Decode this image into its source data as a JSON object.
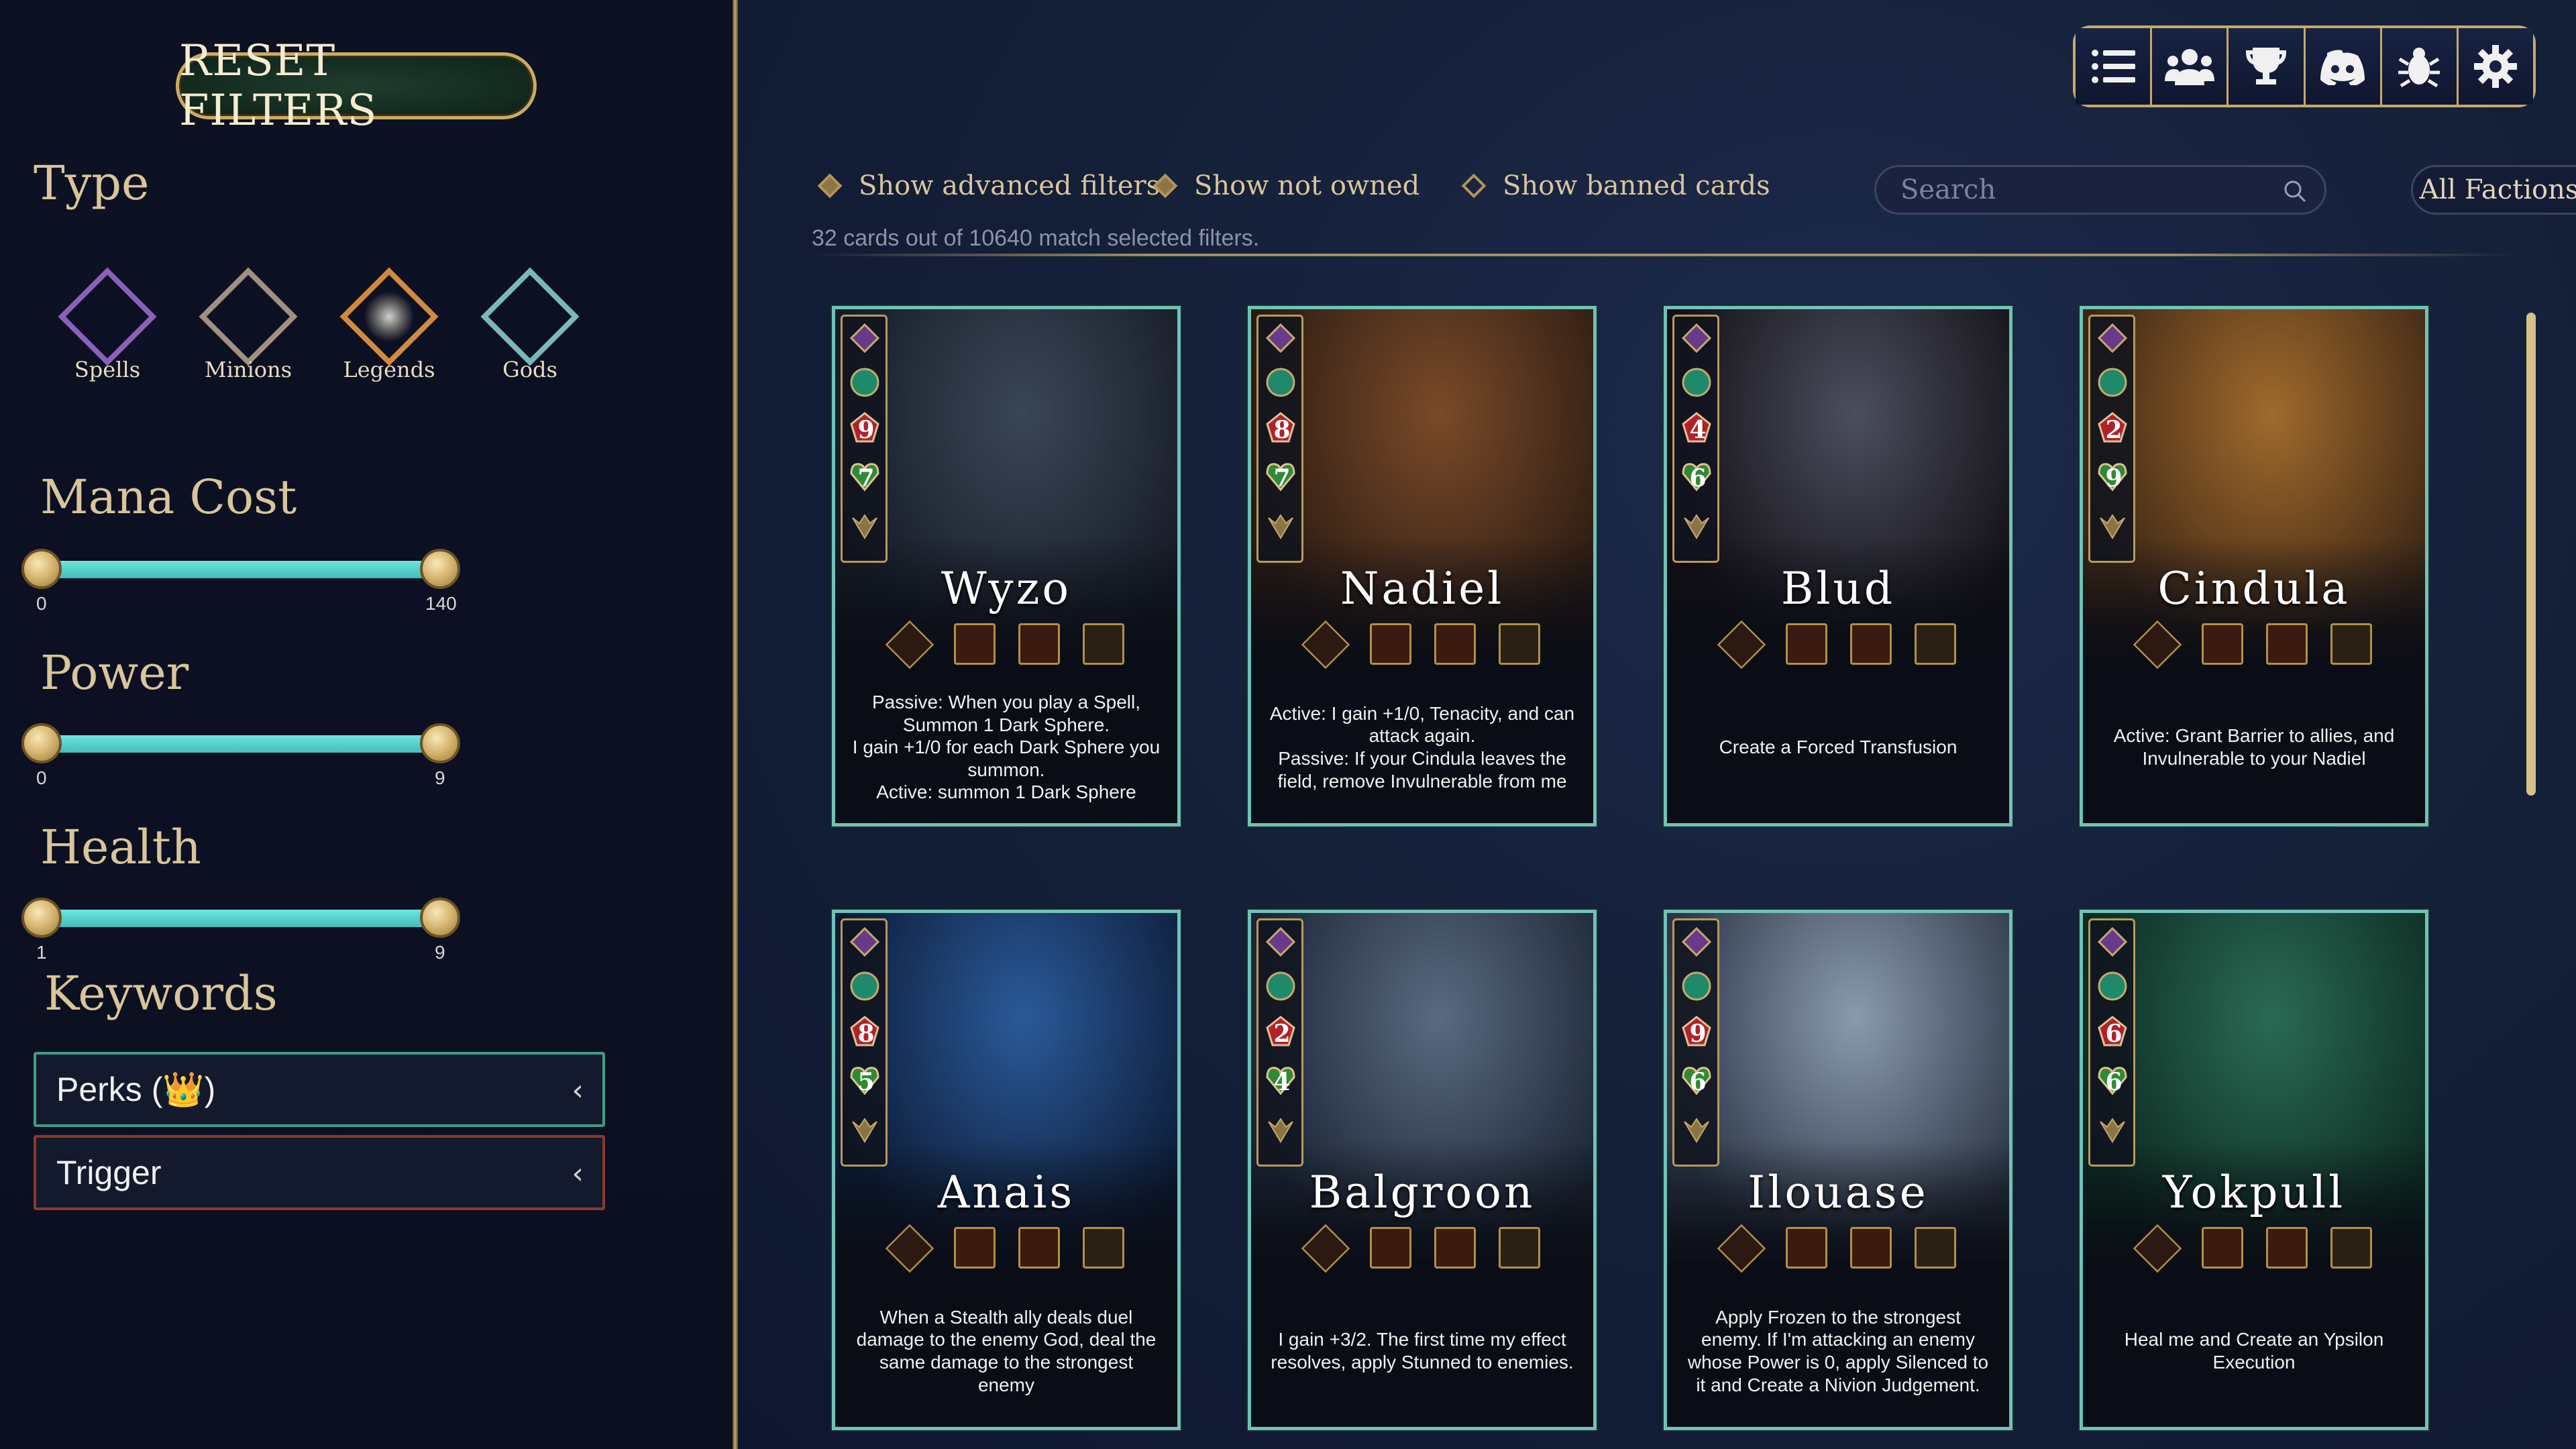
{
  "sidebar": {
    "reset_label": "RESET FILTERS",
    "type_heading": "Type",
    "types": [
      {
        "label": "Spells",
        "color": "#8a60b8"
      },
      {
        "label": "Minions",
        "color": "#a09080"
      },
      {
        "label": "Legends",
        "color": "#d08a40"
      },
      {
        "label": "Gods",
        "color": "#7ab8b8"
      }
    ],
    "mana": {
      "heading": "Mana Cost",
      "min": "0",
      "max": "140"
    },
    "power": {
      "heading": "Power",
      "min": "0",
      "max": "9"
    },
    "health": {
      "heading": "Health",
      "min": "1",
      "max": "9"
    },
    "keywords_heading": "Keywords",
    "keywords": [
      {
        "label": "Perks (👑)",
        "border": "#3f9e8a"
      },
      {
        "label": "Trigger",
        "border": "#8a3a2a"
      }
    ]
  },
  "toolbar": {
    "icons": [
      "list-icon",
      "community-icon",
      "trophy-icon",
      "discord-icon",
      "bug-icon",
      "settings-icon"
    ]
  },
  "filters": {
    "advanced_label": "Show advanced filters",
    "not_owned_label": "Show not owned",
    "banned_label": "Show banned cards",
    "search_placeholder": "Search",
    "faction_label": "All Factions",
    "match_text": "32 cards out of 10640 match selected filters."
  },
  "cards": [
    {
      "name": "Wyzo",
      "power": "9",
      "health": "7",
      "art": [
        "#3a4656",
        "#151b26"
      ],
      "text": [
        "Passive: When you play a Spell, Summon 1 Dark Sphere.",
        "I gain +1/0 for each Dark Sphere you summon.",
        "Active: summon 1 Dark Sphere"
      ]
    },
    {
      "name": "Nadiel",
      "power": "8",
      "health": "7",
      "art": [
        "#7a4a28",
        "#2a1a12"
      ],
      "text": [
        "Active: I gain +1/0, Tenacity, and can attack again.",
        "Passive: If your Cindula leaves the field, remove Invulnerable from me"
      ]
    },
    {
      "name": "Blud",
      "power": "4",
      "health": "6",
      "art": [
        "#4a4e5e",
        "#120e14"
      ],
      "text": [
        "Create a Forced Transfusion"
      ]
    },
    {
      "name": "Cindula",
      "power": "2",
      "health": "9",
      "art": [
        "#a06a2c",
        "#3a2414"
      ],
      "text": [
        "Active: Grant Barrier to allies, and Invulnerable to your Nadiel"
      ]
    },
    {
      "name": "Anais",
      "power": "8",
      "health": "5",
      "art": [
        "#2a5a9a",
        "#0c1a34"
      ],
      "text": [
        "When a Stealth ally deals duel damage to the enemy God, deal the same damage to the strongest enemy"
      ]
    },
    {
      "name": "Balgroon",
      "power": "2",
      "health": "4",
      "art": [
        "#5a6a80",
        "#1a2434"
      ],
      "text": [
        "I gain +3/2. The first time my effect resolves, apply Stunned to enemies."
      ]
    },
    {
      "name": "Ilouase",
      "power": "9",
      "health": "6",
      "art": [
        "#8a9aae",
        "#2a3444"
      ],
      "text": [
        "Apply Frozen to the strongest enemy. If I'm attacking an enemy whose Power is 0, apply Silenced to it and Create a Nivion Judgement."
      ]
    },
    {
      "name": "Yokpull",
      "power": "6",
      "health": "6",
      "art": [
        "#2a6a54",
        "#0c2a20"
      ],
      "text": [
        "Heal me and Create an Ypsilon Execution"
      ]
    }
  ]
}
